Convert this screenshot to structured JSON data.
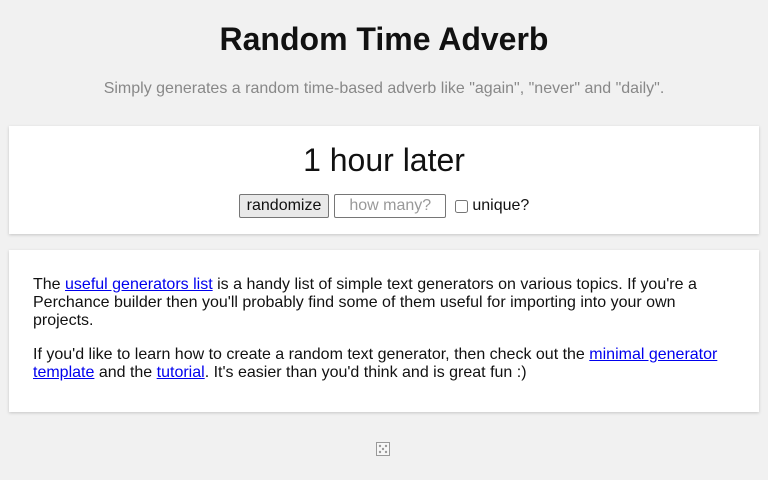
{
  "header": {
    "title": "Random Time Adverb",
    "subtitle": "Simply generates a random time-based adverb like \"again\", \"never\" and \"daily\"."
  },
  "generator": {
    "output": "1 hour later",
    "randomize_label": "randomize",
    "count_placeholder": "how many?",
    "count_value": "",
    "unique_label": "unique?",
    "unique_checked": false
  },
  "info": {
    "p1_before": "The ",
    "p1_link": "useful generators list",
    "p1_after": " is a handy list of simple text generators on various topics. If you're a Perchance builder then you'll probably find some of them useful for importing into your own projects.",
    "p2_before": "If you'd like to learn how to create a random text generator, then check out the ",
    "p2_link1": "minimal generator template",
    "p2_mid": " and the ",
    "p2_link2": "tutorial",
    "p2_after": ". It's easier than you'd think and is great fun :)"
  },
  "footer": {
    "icon": "dice-icon"
  },
  "colors": {
    "background": "#f1f1f1",
    "card": "#ffffff",
    "link": "#0000ee",
    "subtitle": "#888888"
  }
}
